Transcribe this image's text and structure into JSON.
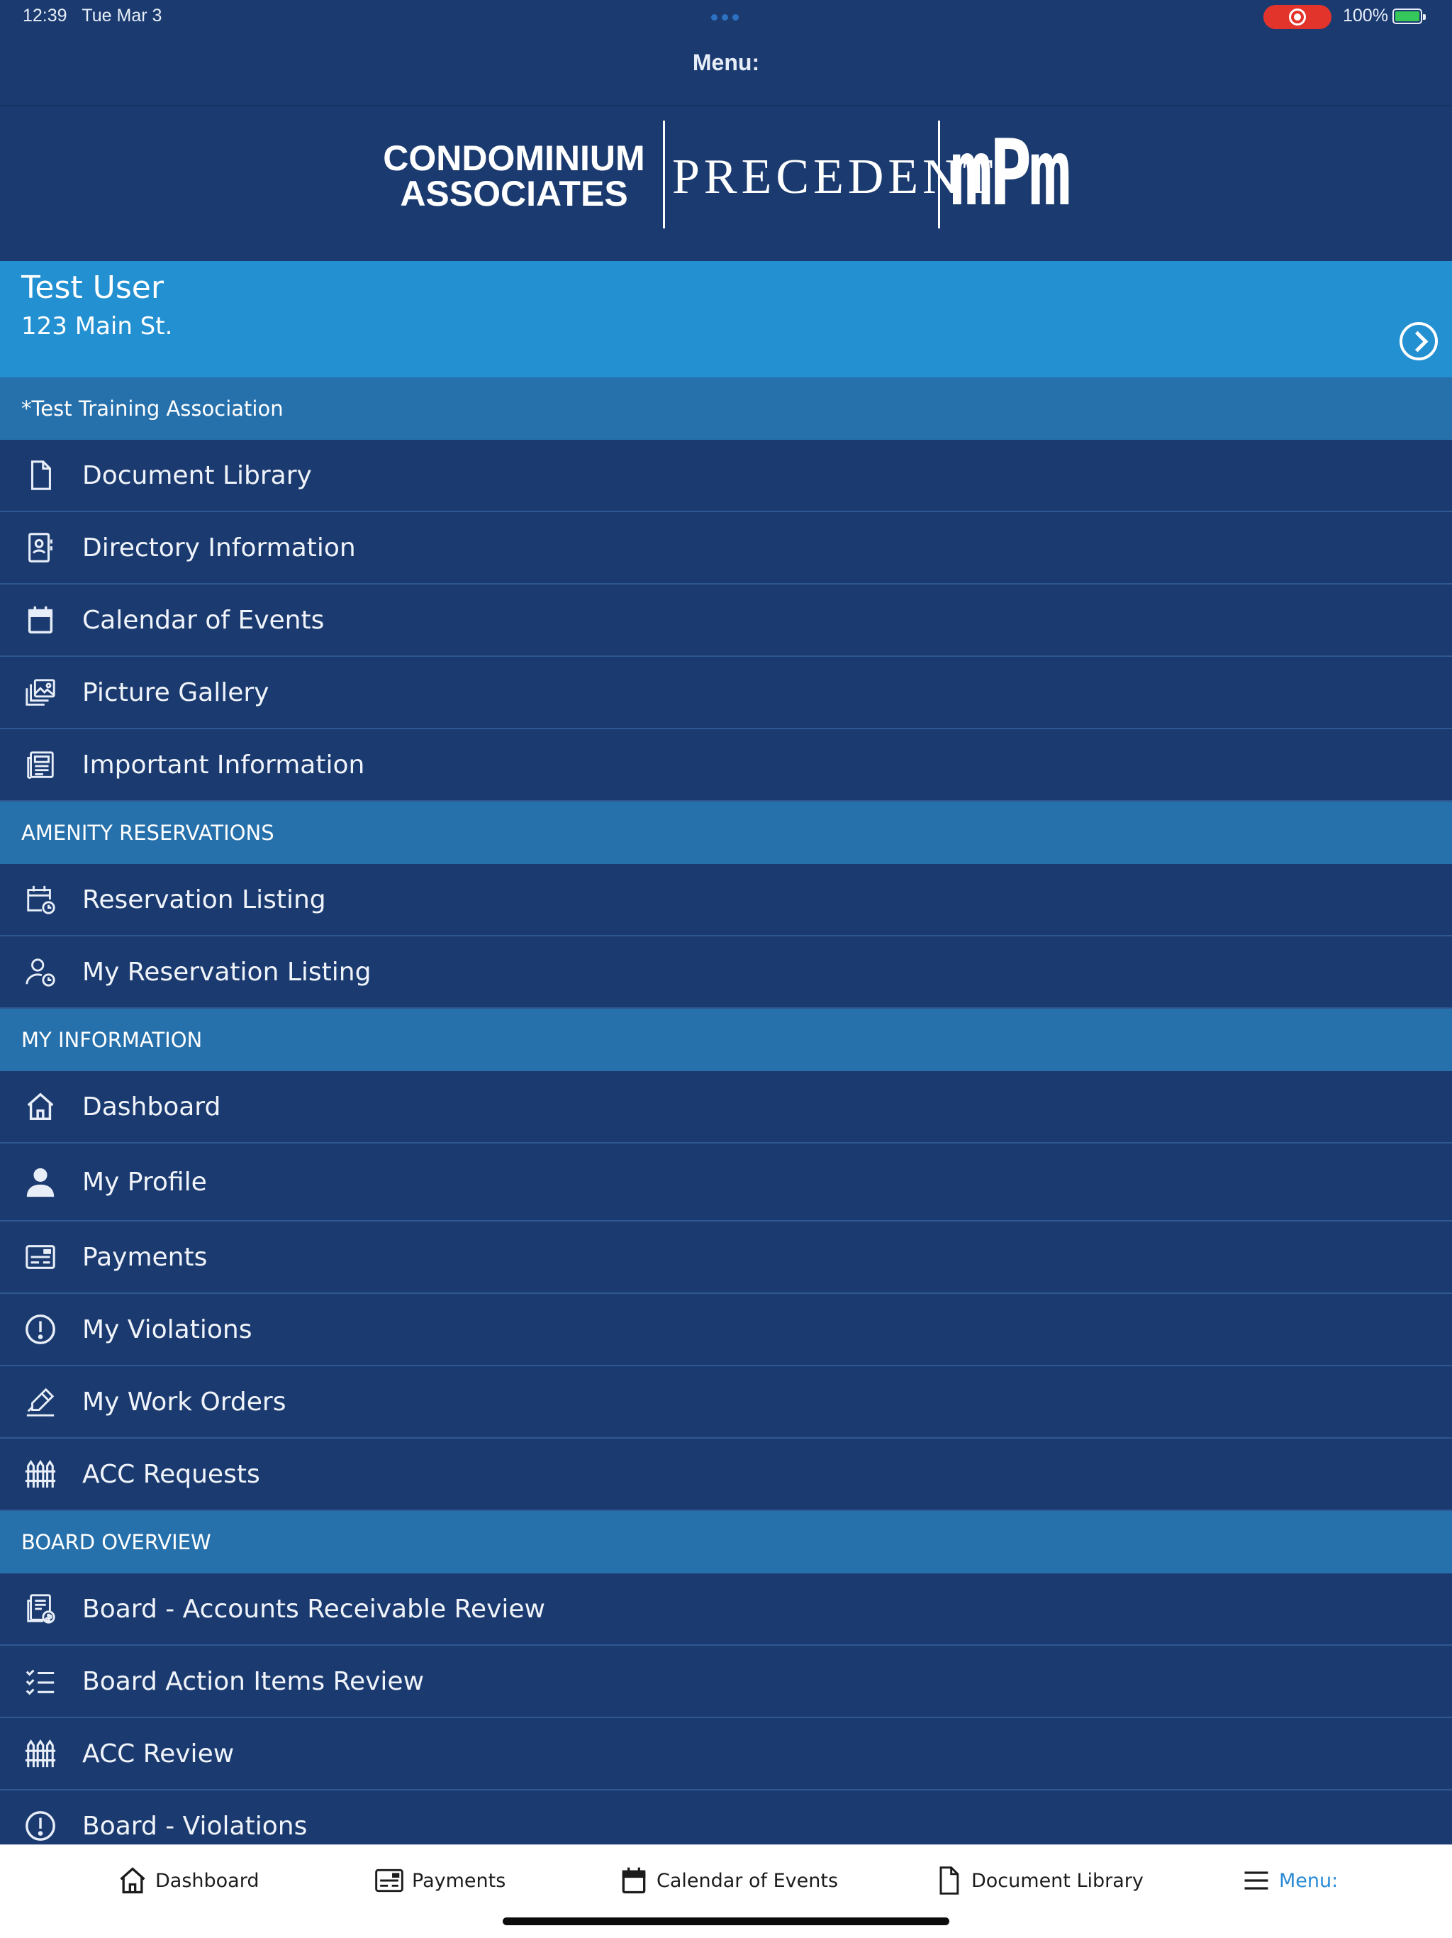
{
  "status": {
    "time": "12:39",
    "date": "Tue Mar 3",
    "battery": "100%"
  },
  "nav": {
    "title": "Menu:"
  },
  "logo": {
    "condo_line1": "CONDOMINIUM",
    "condo_line2": "ASSOCIATES",
    "precedent": "PRECEDENT",
    "mpm": "mPm"
  },
  "user": {
    "name": "Test User",
    "address": "123 Main St."
  },
  "sections": {
    "association": {
      "header": "*Test Training Association",
      "items": [
        {
          "label": "Document Library",
          "icon": "document-icon"
        },
        {
          "label": "Directory Information",
          "icon": "contact-card-icon"
        },
        {
          "label": "Calendar of Events",
          "icon": "calendar-icon"
        },
        {
          "label": "Picture Gallery",
          "icon": "gallery-icon"
        },
        {
          "label": "Important Information",
          "icon": "newspaper-icon"
        }
      ]
    },
    "amenity": {
      "header": "AMENITY RESERVATIONS",
      "items": [
        {
          "label": "Reservation Listing",
          "icon": "calendar-clock-icon"
        },
        {
          "label": "My Reservation Listing",
          "icon": "user-clock-icon"
        }
      ]
    },
    "my_info": {
      "header": "MY INFORMATION",
      "items": [
        {
          "label": "Dashboard",
          "icon": "home-icon"
        },
        {
          "label": "My Profile",
          "icon": "user-icon"
        },
        {
          "label": "Payments",
          "icon": "payment-card-icon"
        },
        {
          "label": "My Violations",
          "icon": "alert-circle-icon"
        },
        {
          "label": "My Work Orders",
          "icon": "edit-pen-icon"
        },
        {
          "label": "ACC Requests",
          "icon": "fence-icon"
        }
      ]
    },
    "board": {
      "header": "BOARD OVERVIEW",
      "items": [
        {
          "label": "Board - Accounts Receivable Review",
          "icon": "receivable-icon"
        },
        {
          "label": "Board Action Items Review",
          "icon": "checklist-icon"
        },
        {
          "label": "ACC Review",
          "icon": "fence-icon"
        },
        {
          "label": "Board - Violations",
          "icon": "alert-circle-icon"
        }
      ]
    }
  },
  "tabs": [
    {
      "label": "Dashboard",
      "icon": "home-icon",
      "active": false
    },
    {
      "label": "Payments",
      "icon": "payment-card-icon",
      "active": false
    },
    {
      "label": "Calendar of Events",
      "icon": "calendar-icon",
      "active": false
    },
    {
      "label": "Document Library",
      "icon": "document-icon",
      "active": false
    },
    {
      "label": "Menu:",
      "icon": "hamburger-icon",
      "active": true
    }
  ],
  "colors": {
    "background": "#1b3b70",
    "user_card": "#2290d1",
    "section_header": "#2670ab",
    "tab_active": "#2a8ad4",
    "record_indicator": "#e3342b"
  }
}
